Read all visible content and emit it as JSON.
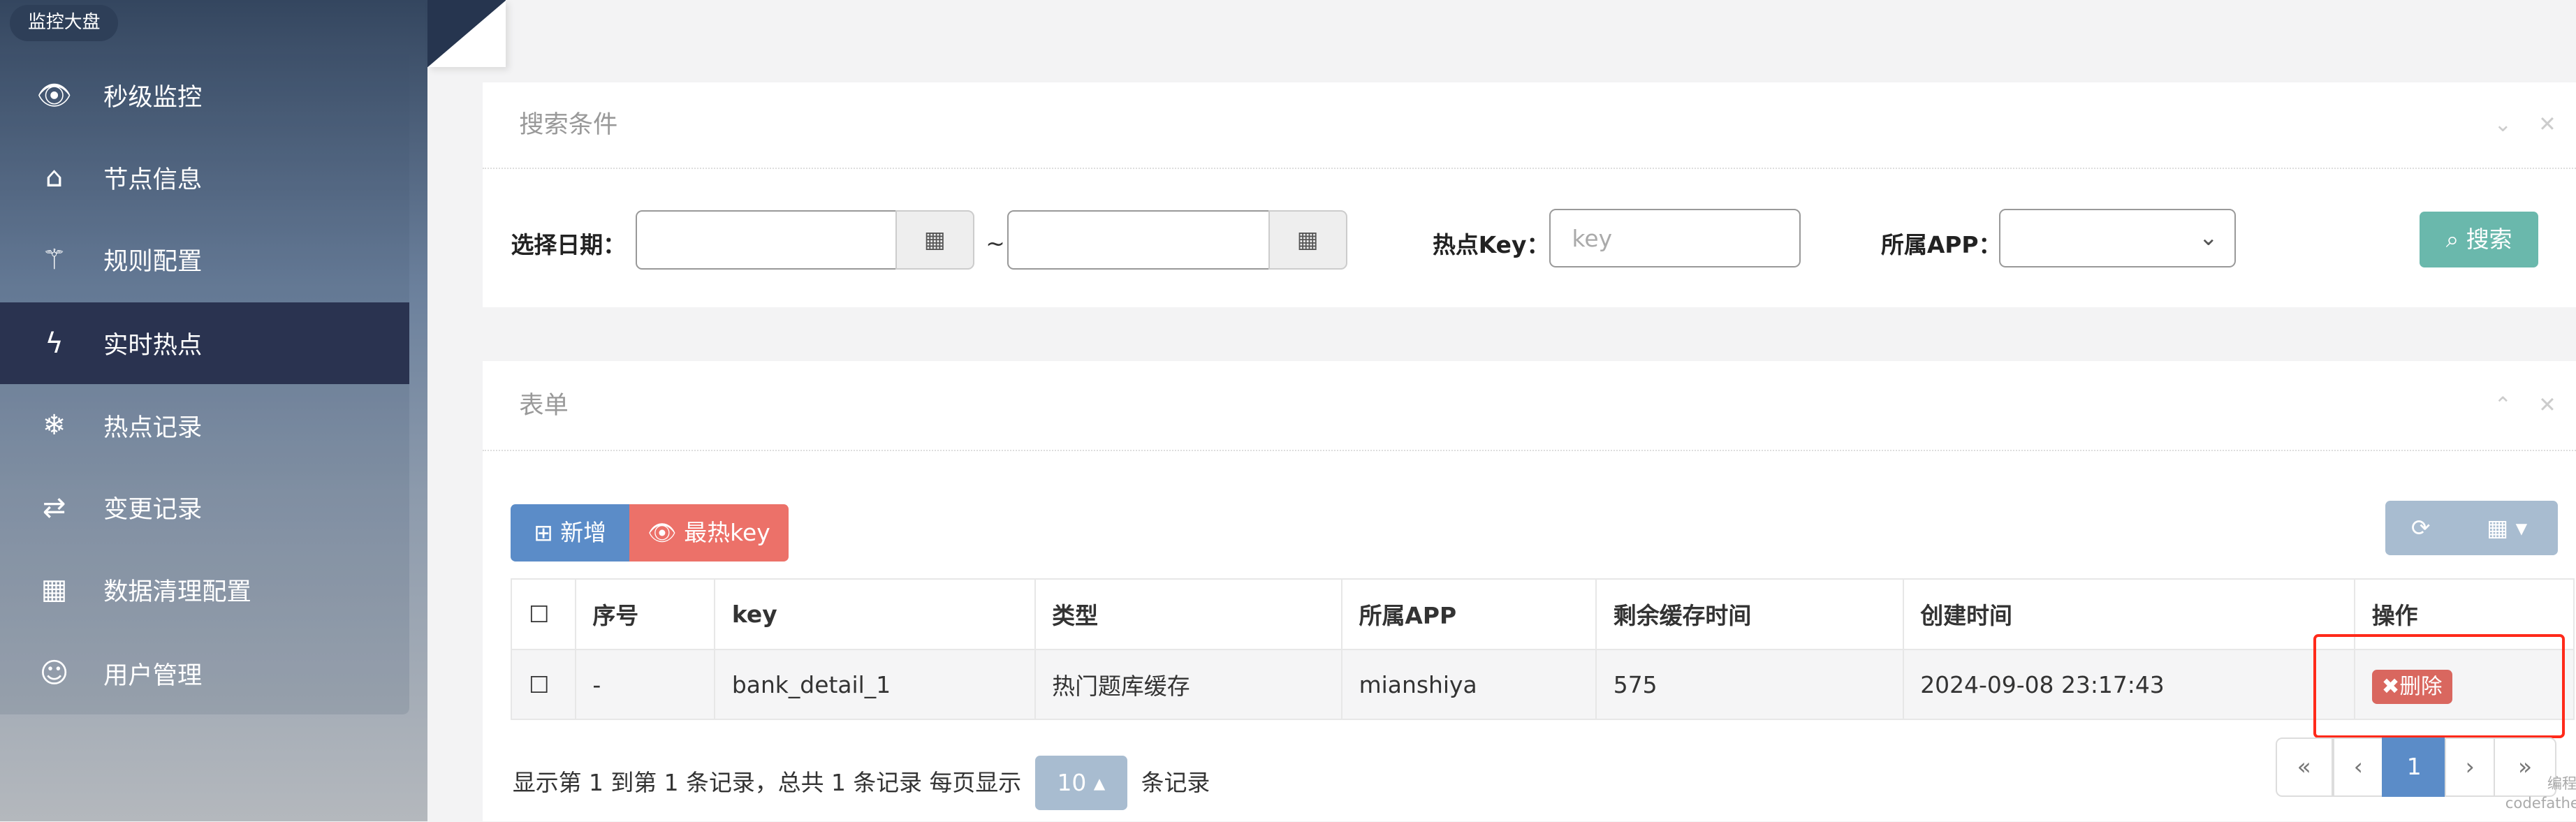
{
  "sidebar": {
    "badge": "监控大盘",
    "items": [
      {
        "label": "秒级监控",
        "icon": "eye-icon"
      },
      {
        "label": "节点信息",
        "icon": "home-icon"
      },
      {
        "label": "规则配置",
        "icon": "magic-wand-icon"
      },
      {
        "label": "实时热点",
        "icon": "bolt-icon",
        "active": true
      },
      {
        "label": "热点记录",
        "icon": "snowflake-icon"
      },
      {
        "label": "变更记录",
        "icon": "retweet-icon"
      },
      {
        "label": "数据清理配置",
        "icon": "cubes-icon"
      },
      {
        "label": "用户管理",
        "icon": "user-icon"
      }
    ]
  },
  "search": {
    "title": "搜索条件",
    "date_label": "选择日期：",
    "tilde": "~",
    "key_label": "热点Key：",
    "key_placeholder": "key",
    "app_label": "所属APP：",
    "search_button": "搜索"
  },
  "table_panel": {
    "title": "表单",
    "add_button": "新增",
    "hottest_button": "最热key",
    "columns": [
      "序号",
      "key",
      "类型",
      "所属APP",
      "剩余缓存时间",
      "创建时间",
      "操作"
    ],
    "rows": [
      {
        "index": "-",
        "key": "bank_detail_1",
        "type": "热门题库缓存",
        "app": "mianshiya",
        "ttl": "575",
        "created": "2024-09-08 23:17:43",
        "action": "删除"
      }
    ],
    "footer_text": "显示第 1 到第 1 条记录，总共 1 条记录 每页显示",
    "page_size": "10",
    "footer_suffix": "条记录",
    "pagination": {
      "first": "«",
      "prev": "‹",
      "current": "1",
      "next": "›",
      "last": "»"
    }
  },
  "watermark": {
    "line1": "编程导航",
    "line2": "codefather.cn"
  },
  "colors": {
    "primary": "#5b8cc8",
    "danger": "#ec7169",
    "success": "#6ab8ac",
    "highlight": "#ff2a1a"
  }
}
